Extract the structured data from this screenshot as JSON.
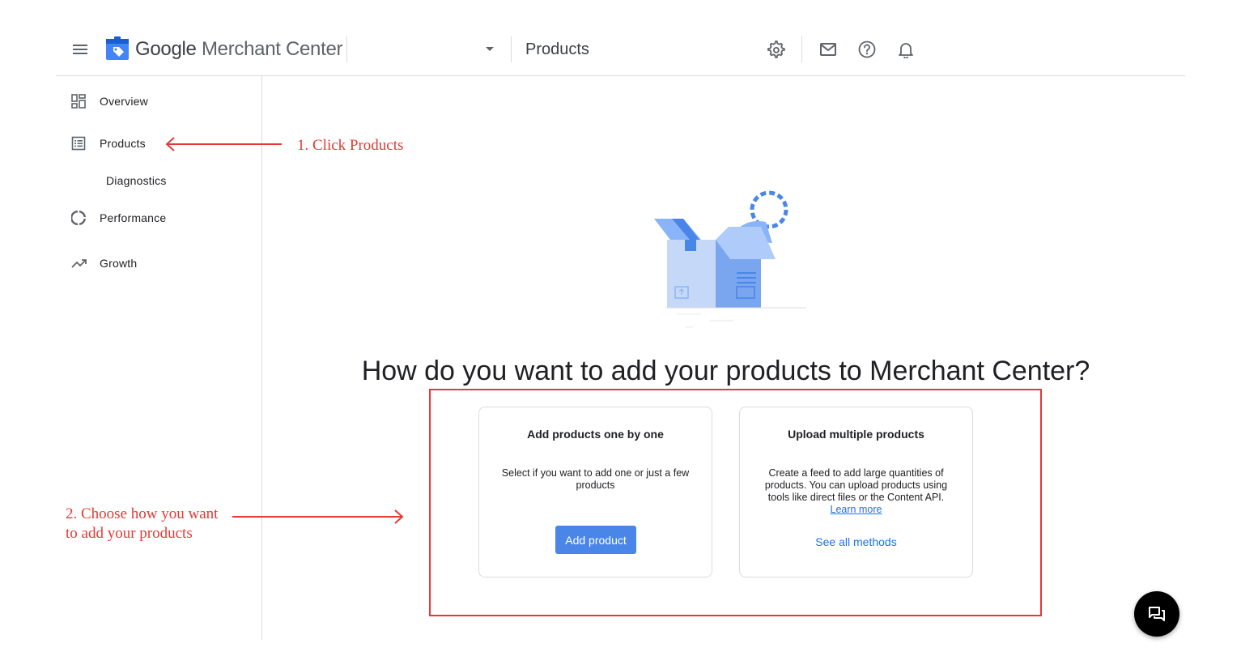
{
  "header": {
    "logo_google": "Google",
    "logo_product": "Merchant Center",
    "account_selector_value": "",
    "page_title": "Products"
  },
  "sidebar": {
    "items": [
      {
        "label": "Overview",
        "icon": "dashboard-icon"
      },
      {
        "label": "Products",
        "icon": "list-icon"
      },
      {
        "label": "Diagnostics",
        "icon": ""
      },
      {
        "label": "Performance",
        "icon": "donut-chart-icon"
      },
      {
        "label": "Growth",
        "icon": "trending-up-icon"
      }
    ]
  },
  "annotations": {
    "step1": "1. Click Products",
    "step2_line1": "2. Choose how you want",
    "step2_line2": "to add your products",
    "color": "#e53935"
  },
  "main": {
    "headline": "How do you want to add your products to Merchant Center?",
    "card_single": {
      "title": "Add products one by one",
      "description": "Select if you want to add one or just a few products",
      "button": "Add product"
    },
    "card_multiple": {
      "title": "Upload multiple products",
      "description": "Create a feed to add large quantities of products. You can upload products using tools like direct files or the Content API.",
      "learn_more": "Learn more",
      "link": "See all methods"
    }
  },
  "colors": {
    "accent": "#4a86e8",
    "link": "#1a73e8",
    "divider": "#dadce0"
  }
}
